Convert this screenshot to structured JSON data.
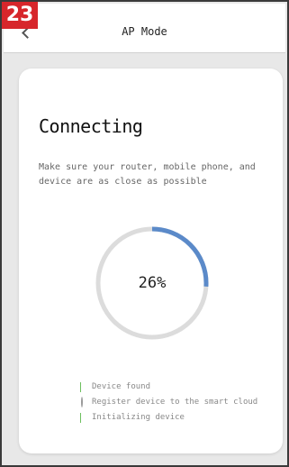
{
  "step_badge": "23",
  "nav": {
    "title": "AP Mode",
    "back_icon": "back-chevron-icon"
  },
  "card": {
    "title": "Connecting",
    "description": "Make sure your router, mobile phone, and device are as close as possible"
  },
  "progress": {
    "label": "26%",
    "value": 0.26,
    "track_color": "#dcdcdc",
    "fill_color": "#5b8ac9"
  },
  "status_items": [
    {
      "label": "Device found",
      "state": "done",
      "icon": "check-icon"
    },
    {
      "label": "Register device to the smart cloud",
      "state": "pending",
      "icon": "pending-dot-icon"
    },
    {
      "label": "Initializing device",
      "state": "done",
      "icon": "check-icon"
    }
  ],
  "colors": {
    "badge": "#d7262b",
    "check": "#6dbf5e"
  }
}
